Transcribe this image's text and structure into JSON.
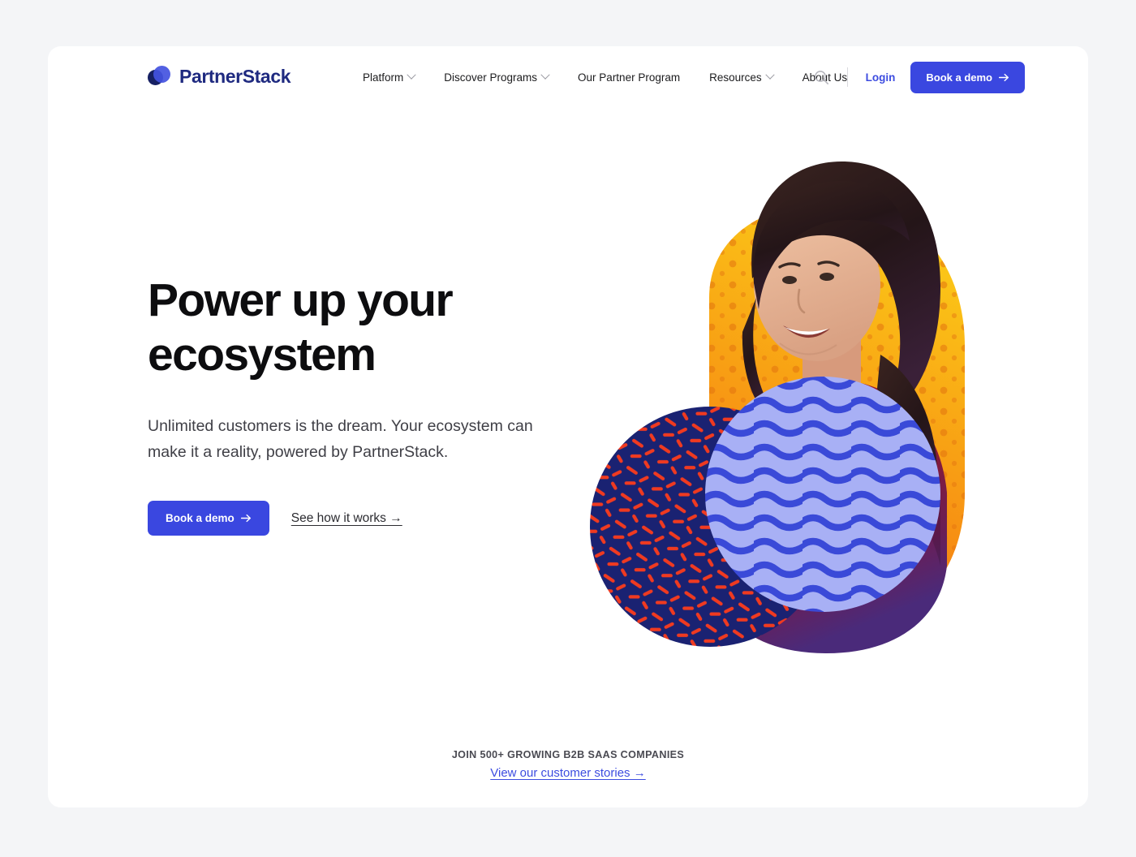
{
  "colors": {
    "page_background": "#f4f5f7",
    "card_background": "#ffffff",
    "brand_blue": "#3a47e0",
    "brand_navy": "#1f2a80",
    "link_blue": "#3d4ce0",
    "art_navy": "#1a2272",
    "art_red": "#f03a20",
    "art_periwinkle": "#a8b0f5",
    "art_wave_blue": "#3a4ad8",
    "art_orange": "#f58220",
    "art_yellow": "#fbc417"
  },
  "nav": {
    "brand_name": "PartnerStack",
    "brand_logo_icon": "partnerstack-circles-logo",
    "links": [
      {
        "label": "Platform",
        "has_dropdown": true
      },
      {
        "label": "Discover Programs",
        "has_dropdown": true
      },
      {
        "label": "Our Partner Program",
        "has_dropdown": false
      },
      {
        "label": "Resources",
        "has_dropdown": true
      },
      {
        "label": "About Us",
        "has_dropdown": false
      }
    ],
    "search_icon": "search-icon",
    "login_label": "Login",
    "cta_label": "Book a demo",
    "cta_icon": "arrow-right-icon"
  },
  "hero": {
    "title_line_1": "Power up your",
    "title_line_2": "ecosystem",
    "subtitle": "Unlimited customers is the dream. Your ecosystem can make it a reality, powered by PartnerStack.",
    "primary_cta_label": "Book a demo",
    "primary_cta_icon": "arrow-right-icon",
    "secondary_cta_label": "See how it works →",
    "image_alt": "Smiling woman in a red sweater with decorative patterned circles"
  },
  "footnote": {
    "label": "JOIN 500+ GROWING B2B SAAS COMPANIES",
    "link_label": "View our customer stories →"
  }
}
